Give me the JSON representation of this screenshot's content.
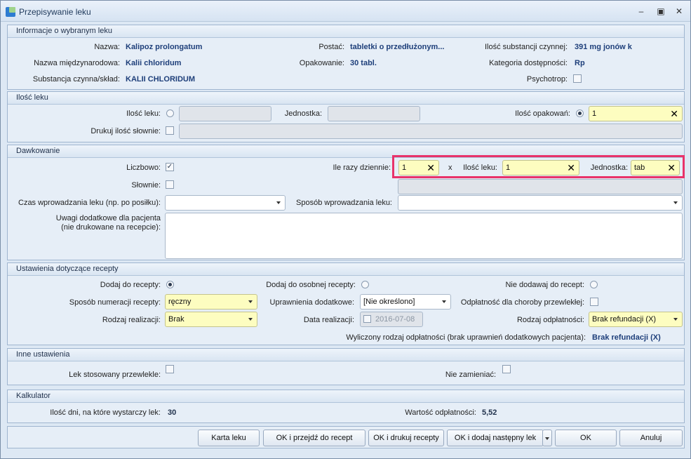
{
  "window": {
    "title": "Przepisywanie leku",
    "minimize": "–",
    "maximize": "▣",
    "close": "✕"
  },
  "info": {
    "header": "Informacje o wybranym leku",
    "name_label": "Nazwa:",
    "name_value": "Kalipoz prolongatum",
    "intl_label": "Nazwa międzynarodowa:",
    "intl_value": "Kalii chloridum",
    "substance_label": "Substancja czynna/skład:",
    "substance_value": "KALII CHLORIDUM",
    "form_label": "Postać:",
    "form_value": "tabletki o przedłużonym...",
    "package_label": "Opakowanie:",
    "package_value": "30 tabl.",
    "amount_label": "Ilość substancji czynnej:",
    "amount_value": "391 mg jonów k",
    "category_label": "Kategoria dostępności:",
    "category_value": "Rp",
    "psycho_label": "Psychotrop:"
  },
  "qty": {
    "header": "Ilość leku",
    "qty_label": "Ilość leku:",
    "unit_label": "Jednostka:",
    "packs_label": "Ilość opakowań:",
    "packs_value": "1",
    "print_words_label": "Drukuj ilość słownie:"
  },
  "dosage": {
    "header": "Dawkowanie",
    "numeric_label": "Liczbowo:",
    "words_label": "Słownie:",
    "times_label": "Ile razy dziennie:",
    "times_value": "1",
    "x": "x",
    "drug_qty_label": "Ilość leku:",
    "drug_qty_value": "1",
    "unit_label": "Jednostka:",
    "unit_value": "tab",
    "time_label": "Czas wprowadzania leku (np. po posiłku):",
    "method_label": "Sposób wprowadzania leku:",
    "notes_label_1": "Uwagi dodatkowe dla pacjenta",
    "notes_label_2": "(nie drukowane na recepcie):"
  },
  "rx": {
    "header": "Ustawienia dotyczące recepty",
    "add_label": "Dodaj do recepty:",
    "separate_label": "Dodaj do osobnej recepty:",
    "noadd_label": "Nie dodawaj do recept:",
    "numbering_label": "Sposób numeracji recepty:",
    "numbering_value": "ręczny",
    "rights_label": "Uprawnienia dodatkowe:",
    "rights_value": "[Nie określono]",
    "chronic_label": "Odpłatność dla choroby przewlekłej:",
    "realization_label": "Rodzaj realizacji:",
    "realization_value": "Brak",
    "date_label": "Data realizacji:",
    "date_value": "2016-07-08",
    "payment_label": "Rodzaj odpłatności:",
    "payment_value": "Brak refundacji (X)",
    "computed_label": "Wyliczony rodzaj odpłatności (brak  uprawnień dodatkowych pacjenta):",
    "computed_value": "Brak refundacji (X)"
  },
  "other": {
    "header": "Inne ustawienia",
    "chronic_drug_label": "Lek stosowany przewlekle:",
    "no_replace_label": "Nie zamieniać:"
  },
  "calc": {
    "header": "Kalkulator",
    "days_label": "Ilość dni, na które wystarczy lek:",
    "days_value": "30",
    "value_label": "Wartość odpłatności:",
    "value_value": "5,52"
  },
  "buttons": {
    "card": "Karta leku",
    "ok_next": "OK i przejdź do recept",
    "ok_print": "OK i drukuj recepty",
    "ok_add": "OK i dodaj następny lek",
    "ok": "OK",
    "cancel": "Anuluj"
  }
}
